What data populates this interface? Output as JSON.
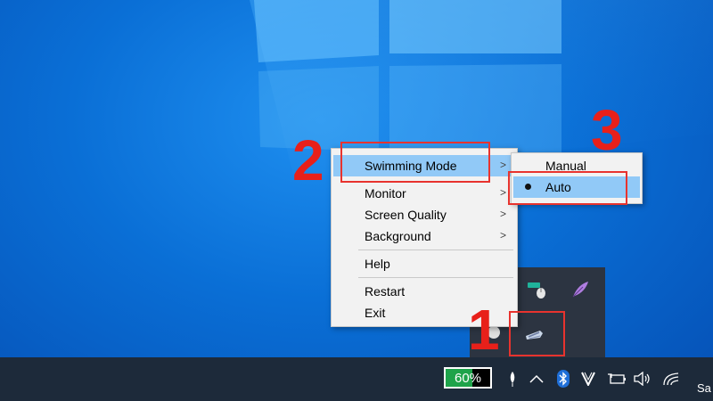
{
  "context_menu": {
    "items": [
      {
        "label": "Swimming Mode",
        "has_submenu": true,
        "highlighted": true
      },
      {
        "label": "Monitor",
        "has_submenu": true
      },
      {
        "label": "Screen Quality",
        "has_submenu": true
      },
      {
        "label": "Background",
        "has_submenu": true
      },
      {
        "label": "Help",
        "has_submenu": false
      },
      {
        "label": "Restart",
        "has_submenu": false
      },
      {
        "label": "Exit",
        "has_submenu": false
      }
    ],
    "submenu_arrow": ">",
    "submenu": {
      "items": [
        {
          "label": "Manual",
          "selected": false
        },
        {
          "label": "Auto",
          "selected": true,
          "highlighted": true
        }
      ]
    }
  },
  "annotations": {
    "step1": "1",
    "step2": "2",
    "step3": "3",
    "color": "#e8201a"
  },
  "taskbar": {
    "battery_percent_text": "60%",
    "battery_level": 0.6,
    "clock_partial": "Sa"
  },
  "colors": {
    "desktop_blue": "#0a6fd6",
    "menu_highlight": "#91c9f7",
    "taskbar_bg": "#1d2a3a",
    "battery_green": "#1ea34a"
  }
}
